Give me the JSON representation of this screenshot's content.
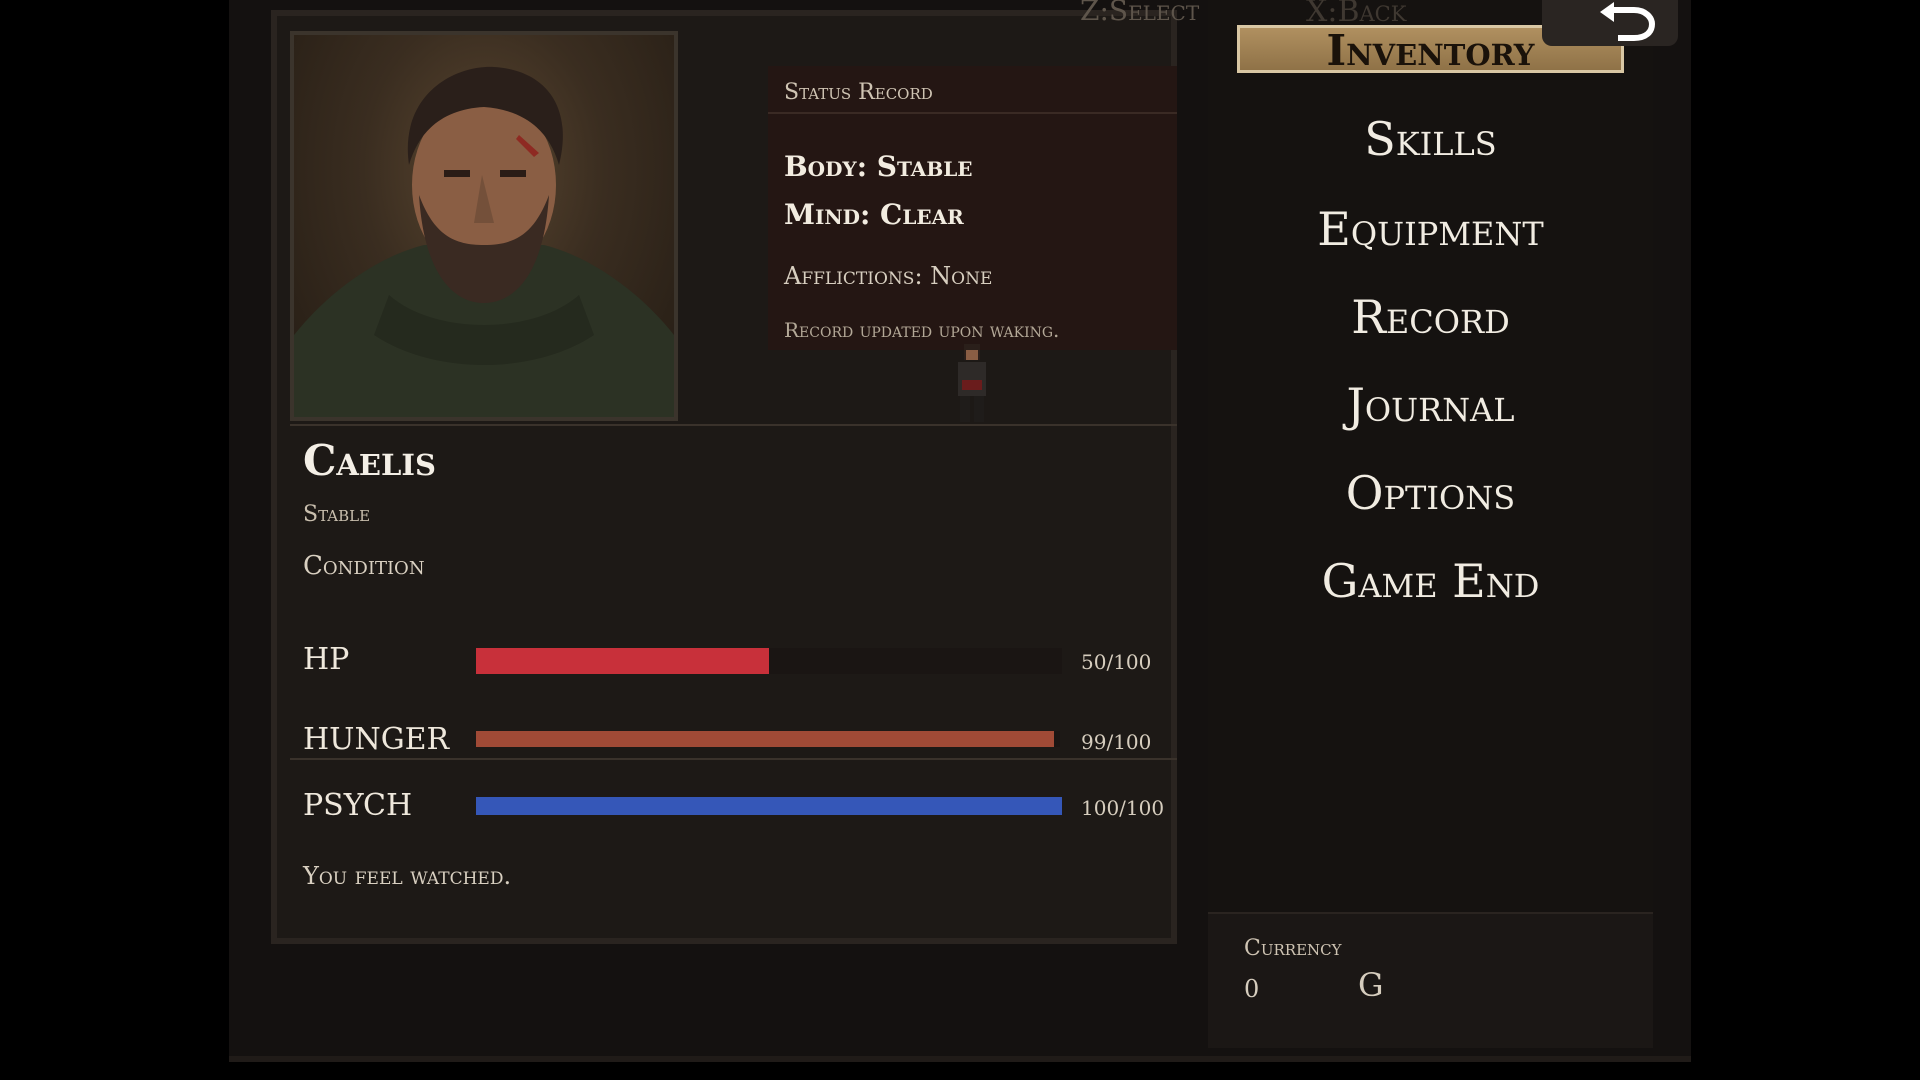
{
  "controls": {
    "select_hint": "Z:Select",
    "back_hint": "X:Back"
  },
  "status_record": {
    "heading": "Status Record",
    "body": "Body: Stable",
    "mind": "Mind: Clear",
    "afflictions": "Afflictions: None",
    "note": "Record updated upon waking."
  },
  "character": {
    "name": "Caelis",
    "state": "Stable",
    "condition_label": "Condition",
    "message": "You feel watched."
  },
  "stats": [
    {
      "label": "HP",
      "value": 50,
      "max": 100,
      "text": "50/100",
      "color": "#c8303a"
    },
    {
      "label": "HUNGER",
      "value": 99,
      "max": 100,
      "text": "99/100",
      "color": "#a04a36"
    },
    {
      "label": "PSYCH",
      "value": 100,
      "max": 100,
      "text": "100/100",
      "color": "#3557b8"
    }
  ],
  "menu": {
    "selected": "Inventory",
    "items": [
      "Inventory",
      "Skills",
      "Equipment",
      "Record",
      "Journal",
      "Options",
      "Game End"
    ]
  },
  "currency": {
    "label": "Currency",
    "amount": "0",
    "unit": "G"
  },
  "icons": {
    "back": "return-arrow-icon"
  }
}
